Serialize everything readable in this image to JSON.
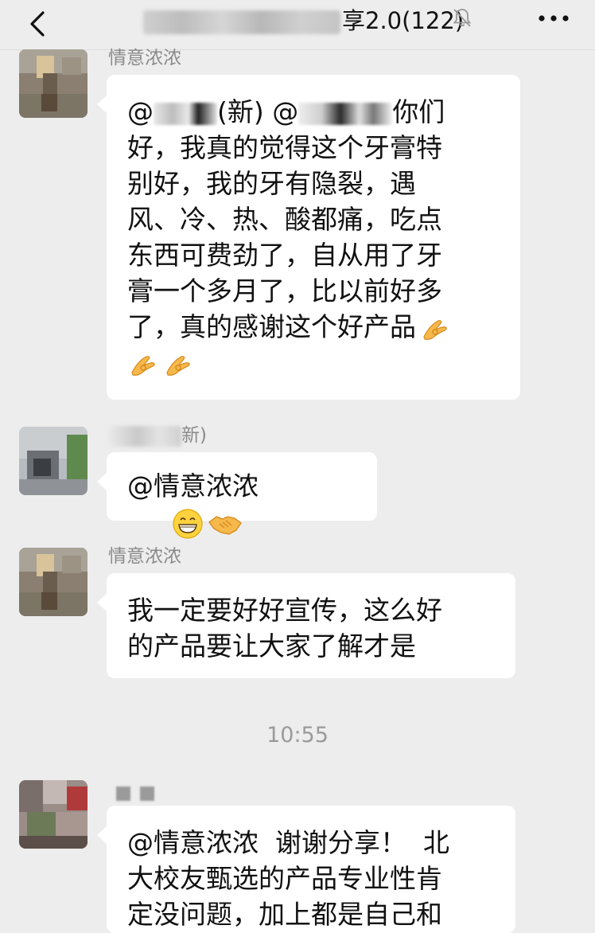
{
  "header": {
    "title_visible": "享2.0(122)",
    "icons": {
      "back": "chevron-left-icon",
      "mute": "bell-slash-icon",
      "more": "ellipsis-icon"
    }
  },
  "messages": [
    {
      "sender": "情意浓浓",
      "lines": [
        {
          "prefix": "@",
          "masked_a": "",
          "mid": "(新) @",
          "masked_b": "",
          "suffix": "你们"
        },
        "好，我真的觉得这个牙膏特",
        "别好，我的牙有隐裂，遇",
        "风、冷、热、酸都痛，吃点",
        "东西可费劲了，自从用了牙",
        "膏一个多月了，比以前好多",
        "了，真的感谢这个好产品"
      ],
      "emoji": "ok-hand-emoji"
    },
    {
      "sender_visible": "新)",
      "text": "@情意浓浓",
      "emojis": [
        "grinning-face-emoji",
        "handshake-emoji"
      ]
    },
    {
      "sender": "情意浓浓",
      "lines": [
        "我一定要好好宣传，这么好",
        "的产品要让大家了解才是"
      ]
    },
    {
      "lines": [
        "@情意浓浓  谢谢分享！  北",
        "大校友甄选的产品专业性肯",
        "定没问题，加上都是自己和"
      ]
    }
  ],
  "timestamp": "10:55",
  "colors": {
    "background": "#ededed",
    "bubble": "#ffffff",
    "sender_text": "#8a8a8a"
  }
}
